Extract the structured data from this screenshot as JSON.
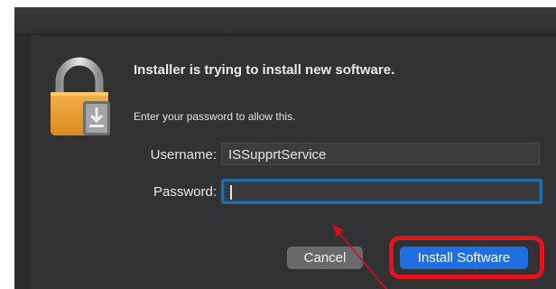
{
  "dialog": {
    "title": "Installer is trying to install new software.",
    "subtitle": "Enter your password to allow this.",
    "lock_icon": "lock-icon",
    "username_label": "Username:",
    "username_value": "ISSupprtService",
    "password_label": "Password:",
    "password_value": "",
    "cancel_label": "Cancel",
    "install_label": "Install Software"
  },
  "annotations": {
    "highlight_color": "#e3141f",
    "arrow_color": "#d0101c"
  },
  "colors": {
    "dialog_background": "#323234",
    "focus_ring": "#1f6fa6",
    "primary_button": "#1f6fe0",
    "secondary_button": "#6a6a6c"
  }
}
